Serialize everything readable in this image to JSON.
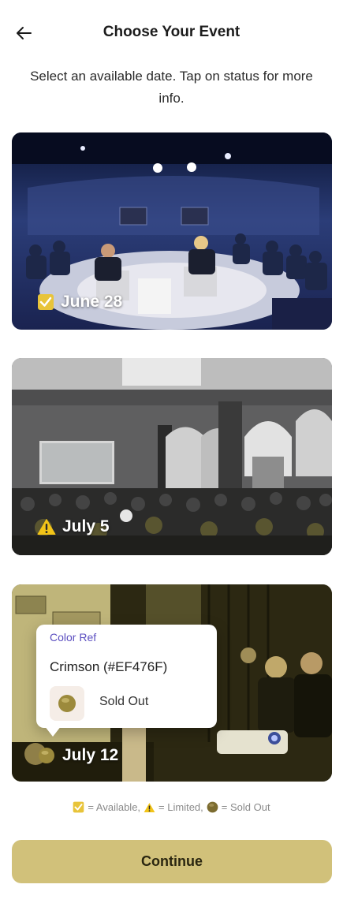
{
  "header": {
    "title": "Choose Your Event",
    "back_icon": "arrow-left-icon"
  },
  "subtitle": "Select an available date. Tap on status for more info.",
  "events": [
    {
      "date": "June 28",
      "status": "available",
      "status_icon": "checkbox-check-icon"
    },
    {
      "date": "July 5",
      "status": "limited",
      "status_icon": "warning-triangle-icon"
    },
    {
      "date": "July 12",
      "status": "sold-out",
      "status_icon": "sold-out-circle-icon"
    }
  ],
  "popover": {
    "heading": "Color Ref",
    "color_name": "Crimson (#EF476F)",
    "status_label": "Sold Out"
  },
  "legend": {
    "available": "= Available,",
    "limited": "= Limited,",
    "sold_out": "= Sold Out"
  },
  "continue_label": "Continue",
  "colors": {
    "accent": "#d1c17a",
    "check": "#e8c43a",
    "warning": "#f2c418",
    "sold_out": "#9c8a3c",
    "popover_heading": "#5b4ec0"
  }
}
